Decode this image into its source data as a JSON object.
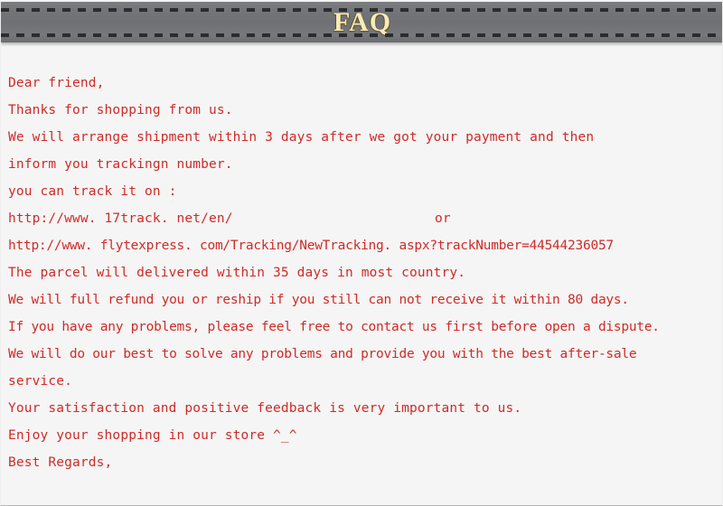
{
  "header": {
    "title": "FAQ",
    "title_color": "#f6e9bd",
    "bar_color": "#727478",
    "dash_color": "#2b2c2e"
  },
  "page": {
    "background_color": "#f5f5f5",
    "text_color": "#cf2b28"
  },
  "body": {
    "lines": [
      {
        "text": "Dear friend,"
      },
      {
        "text": "Thanks for shopping from us."
      },
      {
        "text": "We will arrange shipment within 3 days after we got your payment and then"
      },
      {
        "text": "inform you trackingn number."
      },
      {
        "text": "you can track it on :"
      },
      {
        "text": "http://www. 17track. net/en/",
        "trailing": "or"
      },
      {
        "text": "http://www. flytexpress. com/Tracking/NewTracking. aspx?trackNumber=44544236057"
      },
      {
        "text": "The parcel will delivered within 35 days in most country."
      },
      {
        "text": "We will full refund you or reship if you still can not receive it within 80 days."
      },
      {
        "text": "If you have any problems, please feel free to contact us first before open a dispute."
      },
      {
        "text": "We will do our best to solve any problems and provide you with the best after-sale"
      },
      {
        "text": "service."
      },
      {
        "text": "Your satisfaction and positive feedback is very important to us."
      },
      {
        "text": "Enjoy your shopping in our store ^_^"
      },
      {
        "text": "Best Regards,"
      }
    ]
  }
}
